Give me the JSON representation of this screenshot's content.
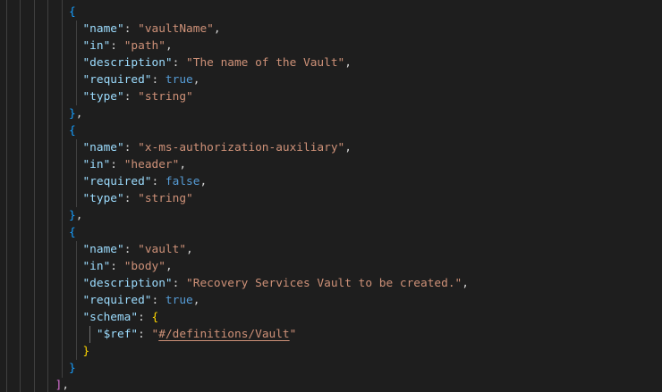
{
  "editor": {
    "lines": [
      [
        [
          "p",
          "          "
        ],
        [
          "b1",
          "}"
        ],
        [
          "p",
          ","
        ]
      ],
      [
        [
          "p",
          "          "
        ],
        [
          "b1",
          "{"
        ]
      ],
      [
        [
          "p",
          "            "
        ],
        [
          "key",
          "\"name\""
        ],
        [
          "p",
          ": "
        ],
        [
          "str",
          "\"vaultName\""
        ],
        [
          "p",
          ","
        ]
      ],
      [
        [
          "p",
          "            "
        ],
        [
          "key",
          "\"in\""
        ],
        [
          "p",
          ": "
        ],
        [
          "str",
          "\"path\""
        ],
        [
          "p",
          ","
        ]
      ],
      [
        [
          "p",
          "            "
        ],
        [
          "key",
          "\"description\""
        ],
        [
          "p",
          ": "
        ],
        [
          "str",
          "\"The name of the Vault\""
        ],
        [
          "p",
          ","
        ]
      ],
      [
        [
          "p",
          "            "
        ],
        [
          "key",
          "\"required\""
        ],
        [
          "p",
          ": "
        ],
        [
          "bool",
          "true"
        ],
        [
          "p",
          ","
        ]
      ],
      [
        [
          "p",
          "            "
        ],
        [
          "key",
          "\"type\""
        ],
        [
          "p",
          ": "
        ],
        [
          "str",
          "\"string\""
        ]
      ],
      [
        [
          "p",
          "          "
        ],
        [
          "b1",
          "}"
        ],
        [
          "p",
          ","
        ]
      ],
      [
        [
          "p",
          "          "
        ],
        [
          "b1",
          "{"
        ]
      ],
      [
        [
          "p",
          "            "
        ],
        [
          "key",
          "\"name\""
        ],
        [
          "p",
          ": "
        ],
        [
          "str",
          "\"x-ms-authorization-auxiliary\""
        ],
        [
          "p",
          ","
        ]
      ],
      [
        [
          "p",
          "            "
        ],
        [
          "key",
          "\"in\""
        ],
        [
          "p",
          ": "
        ],
        [
          "str",
          "\"header\""
        ],
        [
          "p",
          ","
        ]
      ],
      [
        [
          "p",
          "            "
        ],
        [
          "key",
          "\"required\""
        ],
        [
          "p",
          ": "
        ],
        [
          "bool",
          "false"
        ],
        [
          "p",
          ","
        ]
      ],
      [
        [
          "p",
          "            "
        ],
        [
          "key",
          "\"type\""
        ],
        [
          "p",
          ": "
        ],
        [
          "str",
          "\"string\""
        ]
      ],
      [
        [
          "p",
          "          "
        ],
        [
          "b1",
          "}"
        ],
        [
          "p",
          ","
        ]
      ],
      [
        [
          "p",
          "          "
        ],
        [
          "b1",
          "{"
        ]
      ],
      [
        [
          "p",
          "            "
        ],
        [
          "key",
          "\"name\""
        ],
        [
          "p",
          ": "
        ],
        [
          "str",
          "\"vault\""
        ],
        [
          "p",
          ","
        ]
      ],
      [
        [
          "p",
          "            "
        ],
        [
          "key",
          "\"in\""
        ],
        [
          "p",
          ": "
        ],
        [
          "str",
          "\"body\""
        ],
        [
          "p",
          ","
        ]
      ],
      [
        [
          "p",
          "            "
        ],
        [
          "key",
          "\"description\""
        ],
        [
          "p",
          ": "
        ],
        [
          "str",
          "\"Recovery Services Vault to be created.\""
        ],
        [
          "p",
          ","
        ]
      ],
      [
        [
          "p",
          "            "
        ],
        [
          "key",
          "\"required\""
        ],
        [
          "p",
          ": "
        ],
        [
          "bool",
          "true"
        ],
        [
          "p",
          ","
        ]
      ],
      [
        [
          "p",
          "            "
        ],
        [
          "key",
          "\"schema\""
        ],
        [
          "p",
          ": "
        ],
        [
          "b3",
          "{"
        ]
      ],
      [
        [
          "p",
          "              "
        ],
        [
          "key",
          "\"$ref\""
        ],
        [
          "p",
          ": "
        ],
        [
          "str",
          "\""
        ],
        [
          "link",
          "#/definitions/Vault"
        ],
        [
          "str",
          "\""
        ]
      ],
      [
        [
          "p",
          "            "
        ],
        [
          "b3",
          "}"
        ]
      ],
      [
        [
          "p",
          "          "
        ],
        [
          "b1",
          "}"
        ]
      ],
      [
        [
          "p",
          "        "
        ],
        [
          "b2",
          "]"
        ],
        [
          "p",
          ","
        ]
      ]
    ]
  },
  "colors": {
    "background": "#1e1e1e",
    "key": "#9cdcfe",
    "string": "#ce9178",
    "keyword": "#569cd6",
    "bracket1": "#179fff",
    "bracket2": "#da70d6",
    "bracket3": "#ffd700"
  }
}
